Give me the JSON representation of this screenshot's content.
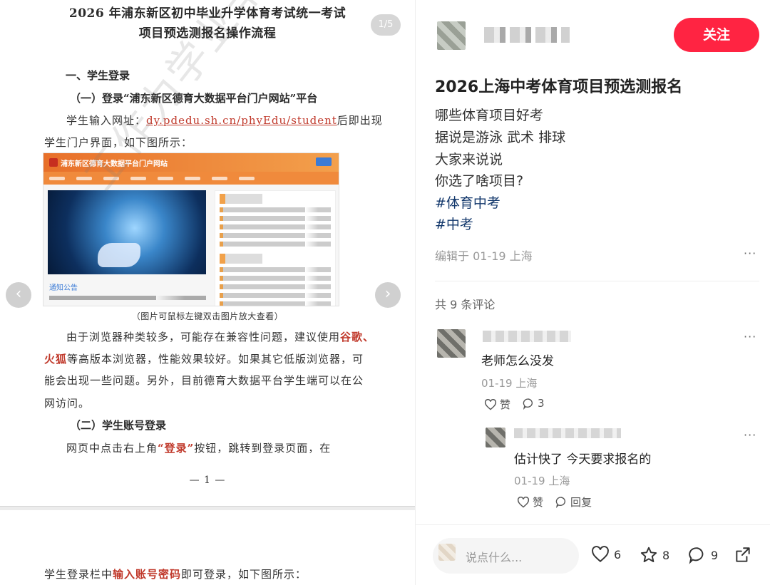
{
  "viewer": {
    "counter": "1/5",
    "prev_glyph": "‹",
    "next_glyph": "›",
    "watermark": "工作为学业辛苦",
    "doc": {
      "title_line1": "2026 年浦东新区初中毕业升学体育考试统一考试",
      "title_line2": "项目预选测报名操作流程",
      "section1": "一、学生登录",
      "sub1": "（一）登录“浦东新区德育大数据平台门户网站”平台",
      "p1_prefix": "学生输入网址：",
      "p1_url": "dy.pdedu.sh.cn/phyEdu/student",
      "p1_suffix": "后即出现",
      "p1_line2": "学生门户界面，如下图所示：",
      "portal_name": "浦东新区德育大数据平台门户网站",
      "portal_notice": "通知公告",
      "caption": "（图片可鼠标左键双击图片放大查看）",
      "p2_line1_prefix": "由于浏览器种类较多，可能存在兼容性问题，建议使用",
      "p2_red1": "谷歌、",
      "p2_red2": "火狐",
      "p2_line2_suffix": "等高版本浏览器，性能效果较好。如果其它低版浏览器，可",
      "p2_line3": "能会出现一些问题。另外，目前德育大数据平台学生端可以在公",
      "p2_line4": "网访问。",
      "sub2": "（二）学生账号登录",
      "p3_prefix": "网页中点击右上角",
      "p3_red": "“登录”",
      "p3_suffix": "按钮，跳转到登录页面，在",
      "page_number": "— 1 —",
      "p4_prefix": "学生登录栏中",
      "p4_red": "输入账号密码",
      "p4_suffix": "即可登录，如下图所示："
    }
  },
  "post": {
    "follow_label": "关注",
    "title": "2026上海中考体育项目预选测报名",
    "lines": [
      "哪些体育项目好考",
      "据说是游泳 武术 排球",
      "大家来说说",
      "你选了啥项目?"
    ],
    "hashtags": [
      "#体育中考",
      "#中考"
    ],
    "meta": "编辑于 01-19 上海",
    "more": "···",
    "comment_count": "共 9 条评论"
  },
  "comments": [
    {
      "text": "老师怎么没发",
      "meta": "01-19 上海",
      "like_label": "赞",
      "reply_count": "3"
    },
    {
      "text": "估计快了 今天要求报名的",
      "meta": "01-19 上海",
      "like_label": "赞",
      "reply_label": "回复"
    }
  ],
  "bottom_bar": {
    "placeholder": "说点什么...",
    "likes": "6",
    "stars": "8",
    "comments": "9"
  },
  "colors": {
    "accent": "#ff2442",
    "hashtag": "#13386c"
  }
}
